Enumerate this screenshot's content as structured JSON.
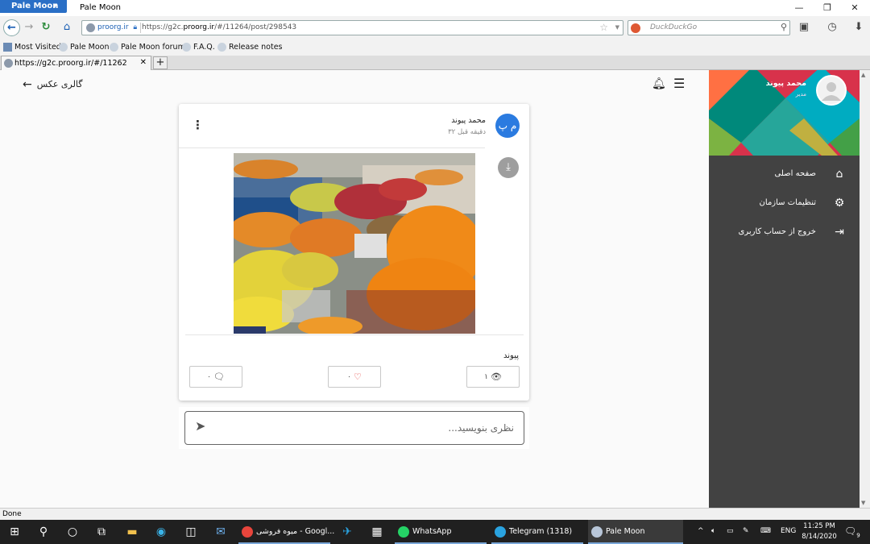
{
  "browser": {
    "menu_label": "Pale Moon",
    "window_title": "Pale Moon",
    "url_identity": "proorg.ir",
    "url_prefix": "https://g2c.",
    "url_domain": "proorg.ir",
    "url_suffix": "/#/11264/post/298543",
    "search_placeholder": "DuckDuckGo",
    "bookmarks": [
      "Most Visited",
      "Pale Moon",
      "Pale Moon forum",
      "F.A.Q.",
      "Release notes"
    ],
    "tab_title": "https://g2c.proorg.ir/#/11262",
    "status_text": "Done"
  },
  "page": {
    "back_label": "گالری عکس",
    "post": {
      "avatar_initials": "م پ",
      "author": "محمد پیوند",
      "time_ago": "۳۲ دقیقه قبل",
      "caption": "پیوند",
      "views": "۱",
      "likes": "۰",
      "comments": "۰"
    },
    "comment_placeholder": "نظری بنویسید..."
  },
  "sidebar": {
    "user_name": "محمد پیوند",
    "user_role": "مدیر",
    "items": [
      {
        "label": "صفحه اصلی",
        "icon": "home-icon"
      },
      {
        "label": "تنظیمات سازمان",
        "icon": "settings-icon"
      },
      {
        "label": "خروج از حساب کاربری",
        "icon": "logout-icon"
      }
    ]
  },
  "taskbar": {
    "apps": [
      {
        "label": "میوه فروشی - Googl...",
        "icon": "chrome-icon"
      },
      {
        "label": "WhatsApp",
        "icon": "whatsapp-icon"
      },
      {
        "label": "Telegram (1318)",
        "icon": "telegram-icon"
      },
      {
        "label": "Pale Moon",
        "icon": "palemoon-icon"
      }
    ],
    "language": "ENG",
    "time": "11:25 PM",
    "date": "8/14/2020",
    "notification_count": "9"
  },
  "colors": {
    "accent": "#2b7be0",
    "sidebar_bg": "#424242",
    "sidebar_header": "#d8324b",
    "like": "#e53935"
  }
}
